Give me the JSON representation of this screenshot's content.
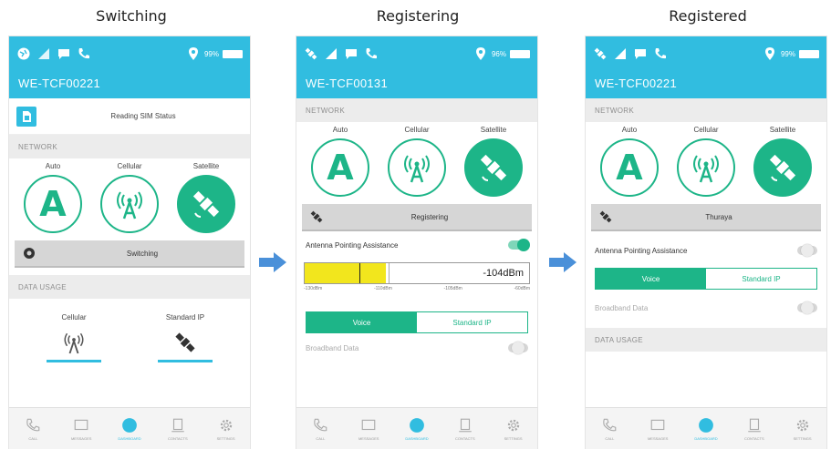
{
  "captions": [
    "Switching",
    "Registering",
    "Registered"
  ],
  "colors": {
    "header": "#31bde0",
    "accent": "#1db588",
    "meter": "#f2e61d",
    "arrow": "#4a90d9"
  },
  "screens": [
    {
      "device": "WE-TCF00221",
      "battery": "99%",
      "sim_status": "Reading SIM Status",
      "network_header": "NETWORK",
      "network": {
        "auto": "Auto",
        "cellular": "Cellular",
        "satellite": "Satellite"
      },
      "status": "Switching",
      "data_usage_header": "DATA USAGE",
      "usage": {
        "cellular": "Cellular",
        "standard_ip": "Standard IP"
      }
    },
    {
      "device": "WE-TCF00131",
      "battery": "96%",
      "network_header": "NETWORK",
      "network": {
        "auto": "Auto",
        "cellular": "Cellular",
        "satellite": "Satellite"
      },
      "status": "Registering",
      "antenna_label": "Antenna Pointing Assistance",
      "meter": {
        "value": "-104dBm",
        "level": 0.36,
        "scale": [
          "-130dBm",
          "-110dBm",
          "-105dBm",
          "-60dBm"
        ]
      },
      "voice": "Voice",
      "standard_ip": "Standard IP",
      "broadband": "Broadband Data"
    },
    {
      "device": "WE-TCF00221",
      "battery": "99%",
      "network_header": "NETWORK",
      "network": {
        "auto": "Auto",
        "cellular": "Cellular",
        "satellite": "Satellite"
      },
      "status": "Thuraya",
      "antenna_label": "Antenna Pointing Assistance",
      "voice": "Voice",
      "standard_ip": "Standard IP",
      "broadband": "Broadband Data",
      "data_usage_header": "DATA USAGE"
    }
  ],
  "nav": [
    "CALL",
    "MESSAGES",
    "DASHBOARD",
    "CONTACTS",
    "SETTINGS"
  ]
}
